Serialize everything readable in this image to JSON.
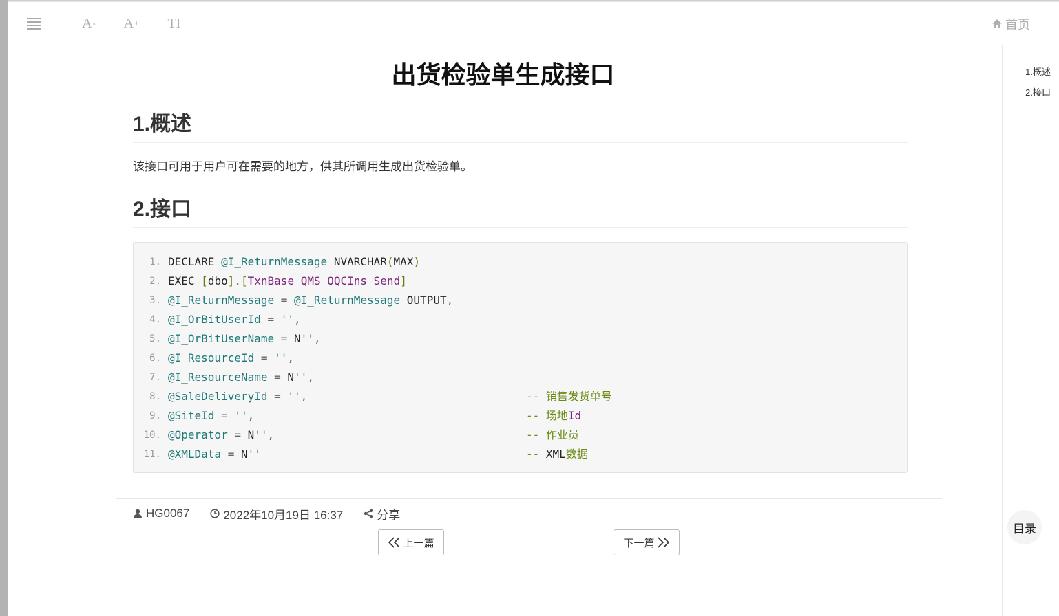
{
  "toolbar": {
    "font_smaller_label": "A",
    "font_smaller_suffix": "-",
    "font_larger_label": "A",
    "font_larger_suffix": "+",
    "text_style_label": "TI"
  },
  "header": {
    "home_label": "首页"
  },
  "article": {
    "title": "出货检验单生成接口",
    "section1_heading": "1.概述",
    "section1_text": "该接口可用于用户可在需要的地方，供其所调用生成出货检验单。",
    "section2_heading": "2.接口"
  },
  "code": {
    "line_numbers": [
      "1.",
      "2.",
      "3.",
      "4.",
      "5.",
      "6.",
      "7.",
      "8.",
      "9.",
      "10.",
      "11."
    ],
    "l1": {
      "kw": "DECLARE ",
      "var": "@I_ReturnMessage",
      "type": " NVARCHAR",
      "po": "(",
      "arg": "MAX",
      "pc": ")"
    },
    "l2": {
      "kw": "EXEC ",
      "b1": "[",
      "schema": "dbo",
      "b2": "]",
      "dot": ".",
      "b3": "[",
      "proc": "TxnBase_QMS_OQCIns_Send",
      "b4": "]"
    },
    "l3": {
      "var": "@I_ReturnMessage",
      "op": " = ",
      "var2": "@I_ReturnMessage",
      "rest": " OUTPUT",
      "comma": ","
    },
    "l4": {
      "var": "@I_OrBitUserId",
      "op": " = ",
      "str": "''",
      "comma": ","
    },
    "l5": {
      "var": "@I_OrBitUserName",
      "op": " = ",
      "prefix": "N",
      "str": "''",
      "comma": ","
    },
    "l6": {
      "var": "@I_ResourceId",
      "op": " = ",
      "str": "''",
      "comma": ","
    },
    "l7": {
      "var": "@I_ResourceName",
      "op": " = ",
      "prefix": "N",
      "str": "''",
      "comma": ","
    },
    "l8": {
      "var": "@SaleDeliveryId",
      "op": " = ",
      "str": "''",
      "comma": ",",
      "comment": "-- 销售发货单号"
    },
    "l9": {
      "var": "@SiteId",
      "op": " = ",
      "str": "''",
      "comma": ",",
      "comment_dash": "-- 场地",
      "comment_id": "Id"
    },
    "l10": {
      "var": "@Operator",
      "op": " = ",
      "prefix": "N",
      "str": "''",
      "comma": ",",
      "comment": "-- 作业员"
    },
    "l11": {
      "var": "@XMLData",
      "op": " = ",
      "prefix": "N",
      "str": "''",
      "comment_dash": "-- ",
      "comment_xml": "XML",
      "comment_cn": "数据"
    }
  },
  "footer": {
    "author": "HG0067",
    "datetime": "2022年10月19日 16:37",
    "share_label": "分享",
    "prev_label": "上一篇",
    "next_label": "下一篇"
  },
  "toc": {
    "items": [
      "1.概述",
      "2.接口"
    ],
    "toggle_label": "目录"
  }
}
